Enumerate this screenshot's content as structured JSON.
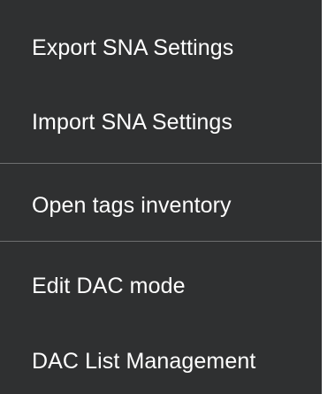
{
  "menu": {
    "items": [
      {
        "label": "Export SNA Settings"
      },
      {
        "label": "Import SNA Settings"
      },
      {
        "label": "Open tags inventory"
      },
      {
        "label": "Edit DAC mode"
      },
      {
        "label": "DAC List Management"
      }
    ],
    "colors": {
      "background": "#2f3031",
      "text": "#ffffff",
      "divider": "#6e6f70"
    }
  }
}
